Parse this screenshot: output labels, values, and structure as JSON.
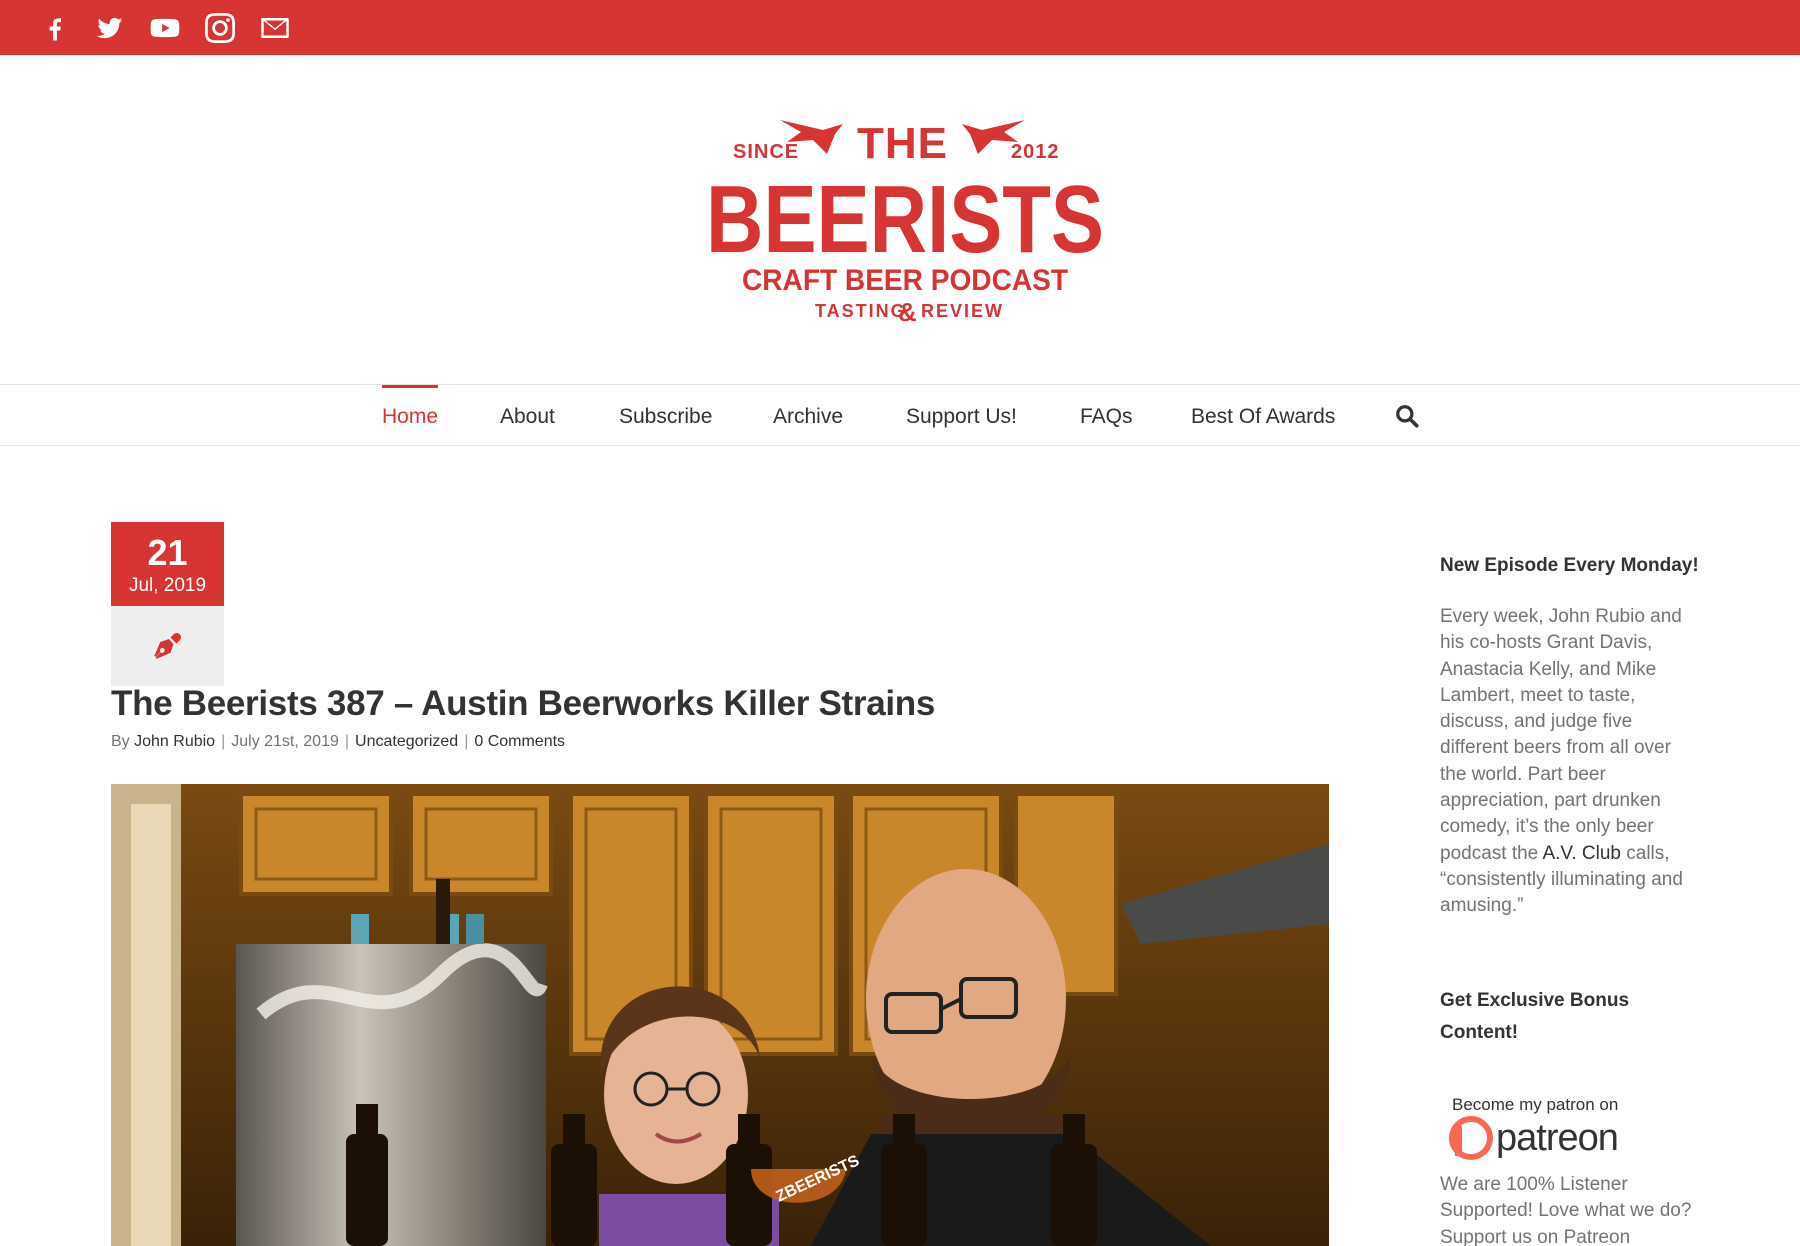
{
  "topbar": {
    "color": "#d73434",
    "social": [
      {
        "icon": "facebook-icon"
      },
      {
        "icon": "twitter-icon"
      },
      {
        "icon": "youtube-icon"
      },
      {
        "icon": "instagram-icon"
      },
      {
        "icon": "email-icon"
      }
    ]
  },
  "logo": {
    "since": "SINCE",
    "the": "THE",
    "year": "2012",
    "name": "BEERISTS",
    "subtitle": "CRAFT BEER PODCAST",
    "tagline_left": "TASTING",
    "tagline_amp": "&",
    "tagline_right": "REVIEW"
  },
  "nav": {
    "items": [
      {
        "label": "Home",
        "active": true
      },
      {
        "label": "About"
      },
      {
        "label": "Subscribe"
      },
      {
        "label": "Archive"
      },
      {
        "label": "Support Us!"
      },
      {
        "label": "FAQs"
      },
      {
        "label": "Best Of Awards"
      }
    ],
    "search_icon": "search-icon"
  },
  "post": {
    "date_day": "21",
    "date_month": "Jul, 2019",
    "format_icon": "pen-icon",
    "title": "The Beerists 387 – Austin Beerworks Killer Strains",
    "meta": {
      "by": "By",
      "author": "John Rubio",
      "date": "July 21st, 2019",
      "category": "Uncategorized",
      "comments": "0 Comments"
    },
    "image_caption": "ZBEERISTS"
  },
  "sidebar": {
    "widget1_title": "New Episode Every Monday!",
    "widget1_text_a": "Every week, John Rubio and his co-hosts Grant Davis, Anastacia Kelly, and Mike Lambert, meet to taste, discuss, and judge five different beers from all over the world. Part beer appreciation, part drunken comedy, it’s the only beer podcast the ",
    "widget1_link": "A.V. Club",
    "widget1_text_b": " calls, “consistently illuminating and amusing.”",
    "widget2_title": "Get Exclusive Bonus Content!",
    "patreon_line1": "Become my patron on",
    "patreon_line2": "patreon",
    "widget2_text": "We are 100% Listener Supported! Love what we do? Support us on Patreon"
  }
}
